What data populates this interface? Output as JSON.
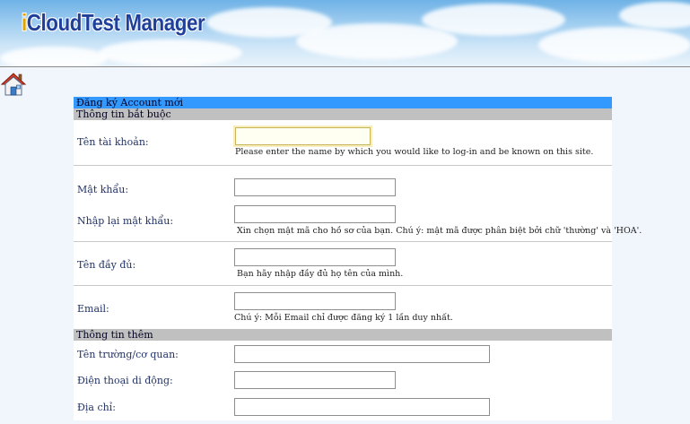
{
  "app": {
    "logo_i": "i",
    "logo_rest": "CloudTest Manager"
  },
  "form": {
    "title": "Đăng ký Account mới",
    "required_section": "Thông tin bắt buộc",
    "optional_section": "Thông tin thêm",
    "username": {
      "label": "Tên tài khoản:",
      "value": "",
      "hint": "Please enter the name by which you would like to log-in and be known on this site."
    },
    "password": {
      "label": "Mật khẩu:",
      "value": ""
    },
    "confirm_password": {
      "label": "Nhập lại mật khẩu:",
      "value": "",
      "hint": "Xin chọn mật mã cho hồ sơ của bạn. Chú ý: mật mã được phân biệt bởi chữ 'thường' và 'HOA'."
    },
    "fullname": {
      "label": "Tên đầy đủ:",
      "value": "",
      "hint": "Bạn hãy nhập đầy đủ họ tên của mình."
    },
    "email": {
      "label": "Email:",
      "value": "",
      "hint": "Chú ý: Mỗi Email chỉ được đăng ký 1 lần duy nhất."
    },
    "school": {
      "label": "Tên trường/cơ quan:",
      "value": ""
    },
    "mobile": {
      "label": "Điện thoại di động:",
      "value": ""
    },
    "address": {
      "label": "Địa chỉ:",
      "value": ""
    }
  },
  "colors": {
    "title_bar": "#3399ff",
    "section_bar": "#c0c0c0",
    "logo_text": "#1f3f9a",
    "logo_i": "#e0a400"
  }
}
